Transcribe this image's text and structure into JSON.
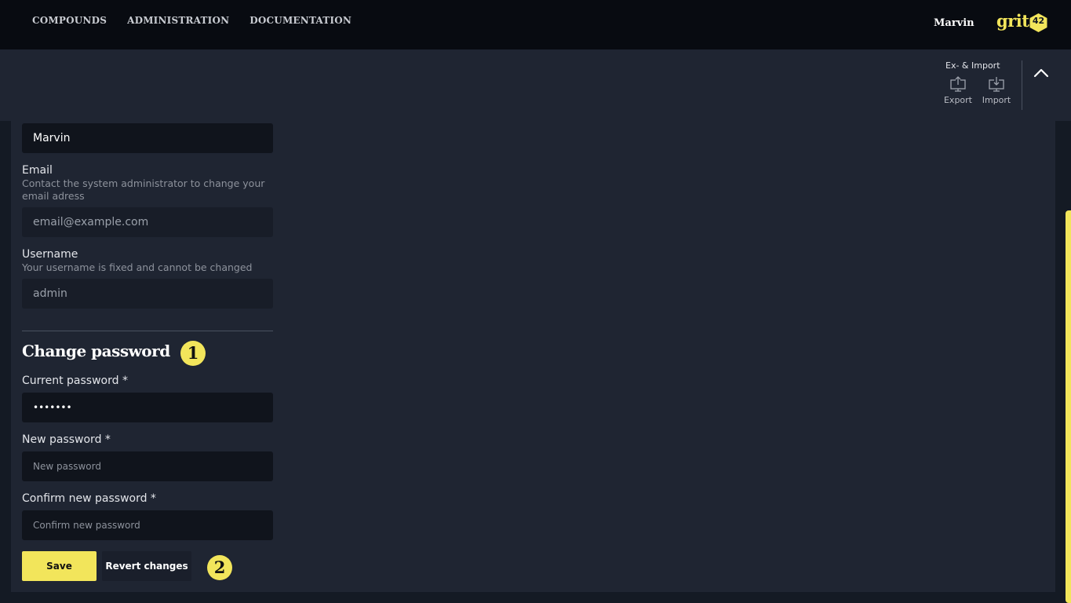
{
  "nav": {
    "items": [
      {
        "label": "COMPOUNDS"
      },
      {
        "label": "ADMINISTRATION"
      },
      {
        "label": "DOCUMENTATION"
      }
    ],
    "user_name": "Marvin",
    "logo_text": "grit",
    "logo_number": "42"
  },
  "toolbar": {
    "group_title": "Ex- & Import",
    "export_label": "Export",
    "import_label": "Import",
    "export_icon": "export-icon",
    "import_icon": "import-icon",
    "collapse_icon": "chevron-up-icon"
  },
  "profile": {
    "name_value": "Marvin",
    "email_label": "Email",
    "email_hint": "Contact the system administrator to change your email adress",
    "email_value": "email@example.com",
    "username_label": "Username",
    "username_hint": "Your username is fixed and cannot be changed",
    "username_value": "admin"
  },
  "password": {
    "section_title": "Change password",
    "current_label": "Current password *",
    "current_value": "•••••••",
    "new_label": "New password *",
    "new_placeholder": "New password",
    "confirm_label": "Confirm new password *",
    "confirm_placeholder": "Confirm new password"
  },
  "actions": {
    "save_label": "Save",
    "revert_label": "Revert changes"
  },
  "markers": {
    "marker_1": "1",
    "marker_2": "2"
  },
  "colors": {
    "accent": "#f2e55b",
    "page_bg": "#141a24",
    "card_bg": "#1f2532",
    "topbar_bg": "#080b11",
    "input_bg": "#10141c"
  }
}
